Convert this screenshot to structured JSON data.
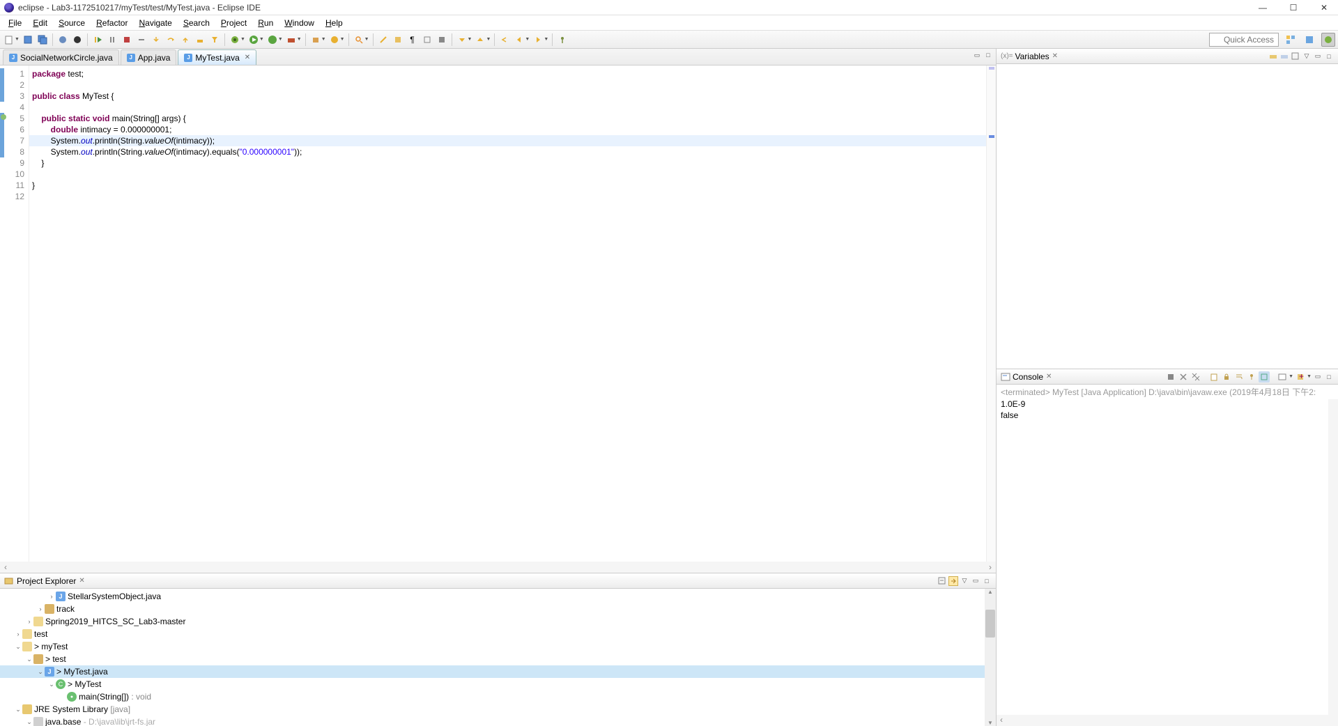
{
  "titlebar": {
    "text": "eclipse - Lab3-1172510217/myTest/test/MyTest.java - Eclipse IDE"
  },
  "menus": [
    "File",
    "Edit",
    "Source",
    "Refactor",
    "Navigate",
    "Search",
    "Project",
    "Run",
    "Window",
    "Help"
  ],
  "quick_access": "Quick Access",
  "editor": {
    "tabs": [
      {
        "label": "SocialNetworkCircle.java",
        "active": false
      },
      {
        "label": "App.java",
        "active": false
      },
      {
        "label": "MyTest.java",
        "active": true
      }
    ],
    "lines": [
      {
        "n": 1,
        "html": "<span class='kw'>package</span> test;"
      },
      {
        "n": 2,
        "html": ""
      },
      {
        "n": 3,
        "html": "<span class='kw'>public</span> <span class='kw'>class</span> MyTest {"
      },
      {
        "n": 4,
        "html": ""
      },
      {
        "n": 5,
        "html": "    <span class='kw'>public</span> <span class='kw'>static</span> <span class='kw'>void</span> main(String[] args) {"
      },
      {
        "n": 6,
        "html": "        <span class='kw'>double</span> intimacy = 0.000000001;"
      },
      {
        "n": 7,
        "html": "        System.<span class='fld'>out</span>.println(String.<span class='mth'>valueOf</span>(intimacy));",
        "hl": true
      },
      {
        "n": 8,
        "html": "        System.<span class='fld'>out</span>.println(String.<span class='mth'>valueOf</span>(intimacy).equals(<span class='str'>\"0.000000001\"</span>));"
      },
      {
        "n": 9,
        "html": "    }"
      },
      {
        "n": 10,
        "html": ""
      },
      {
        "n": 11,
        "html": "}"
      },
      {
        "n": 12,
        "html": ""
      }
    ]
  },
  "explorer": {
    "title": "Project Explorer",
    "tree": [
      {
        "indent": 3,
        "exp": "›",
        "icon": "java",
        "glyph": "J",
        "label": "StellarSystemObject.java"
      },
      {
        "indent": 2,
        "exp": "›",
        "icon": "pkg",
        "glyph": "",
        "label": "track"
      },
      {
        "indent": 1,
        "exp": "›",
        "icon": "fld",
        "glyph": "",
        "label": "Spring2019_HITCS_SC_Lab3-master"
      },
      {
        "indent": 0,
        "exp": "›",
        "icon": "fld",
        "glyph": "",
        "label": "test"
      },
      {
        "indent": 0,
        "exp": "⌄",
        "icon": "fld",
        "glyph": "",
        "label": "> myTest"
      },
      {
        "indent": 1,
        "exp": "⌄",
        "icon": "pkg",
        "glyph": "",
        "label": "> test"
      },
      {
        "indent": 2,
        "exp": "⌄",
        "icon": "java",
        "glyph": "J",
        "label": "> MyTest.java",
        "sel": true
      },
      {
        "indent": 3,
        "exp": "⌄",
        "icon": "cls",
        "glyph": "C",
        "label": "> MyTest"
      },
      {
        "indent": 4,
        "exp": "",
        "icon": "mtd",
        "glyph": "●",
        "label": "main(String[]) ",
        "ret": ": void"
      },
      {
        "indent": 0,
        "exp": "⌄",
        "icon": "lib",
        "glyph": "",
        "label": "JRE System Library ",
        "ret": "[java]"
      },
      {
        "indent": 1,
        "exp": "⌄",
        "icon": "jar",
        "glyph": "",
        "label": "java.base ",
        "path": "- D:\\java\\lib\\jrt-fs.jar"
      }
    ]
  },
  "variables": {
    "title": "Variables"
  },
  "console": {
    "title": "Console",
    "status": "<terminated> MyTest [Java Application] D:\\java\\bin\\javaw.exe (2019年4月18日 下午2:",
    "output": [
      "1.0E-9",
      "false"
    ]
  }
}
